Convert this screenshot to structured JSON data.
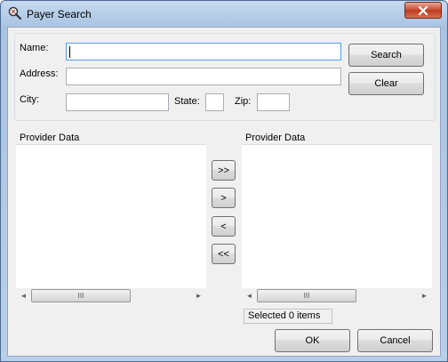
{
  "window": {
    "title": "Payer Search",
    "icon": "payer-search-app-icon",
    "close_icon": "close-icon"
  },
  "search": {
    "name_label": "Name:",
    "address_label": "Address:",
    "city_label": "City:",
    "state_label": "State:",
    "zip_label": "Zip:",
    "name_value": "",
    "address_value": "",
    "city_value": "",
    "state_value": "",
    "zip_value": "",
    "search_button": "Search",
    "clear_button": "Clear"
  },
  "left_list": {
    "header": "Provider Data",
    "items": []
  },
  "right_list": {
    "header": "Provider Data",
    "items": []
  },
  "transfer": {
    "move_all_right": ">>",
    "move_right": ">",
    "move_left": "<",
    "move_all_left": "<<"
  },
  "scrollbar": {
    "left_arrow": "◄",
    "right_arrow": "►",
    "thumb_grip": "III"
  },
  "status": {
    "selected_text": "Selected 0 items"
  },
  "footer": {
    "ok_button": "OK",
    "cancel_button": "Cancel"
  },
  "colors": {
    "title_bar": "#b9cfe8",
    "close_button": "#c7452c",
    "focus_border": "#569de5"
  }
}
